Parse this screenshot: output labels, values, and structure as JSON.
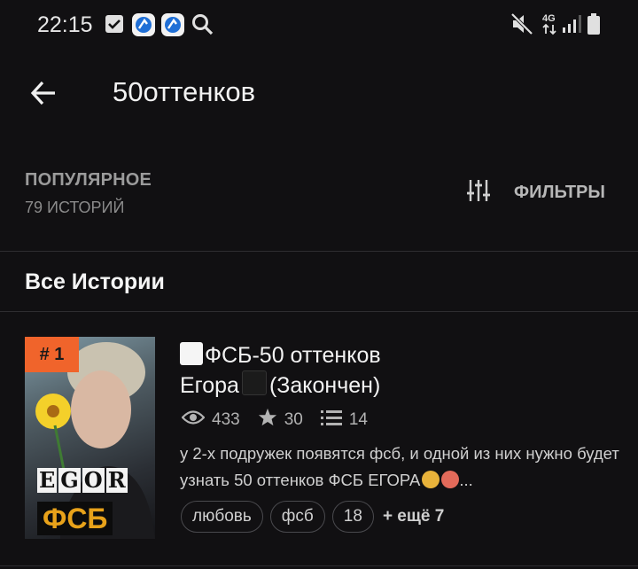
{
  "status_bar": {
    "time": "22:15",
    "icons": [
      "checkbox-notification-icon",
      "app-icon",
      "app-icon",
      "search-icon",
      "mute-icon",
      "network-4g-icon",
      "signal-icon",
      "battery-icon"
    ],
    "network_label": "4G"
  },
  "app_bar": {
    "back_icon": "arrow-left-icon",
    "search_query": "50оттенков"
  },
  "sort": {
    "label": "ПОПУЛЯРНОЕ",
    "count": "79 ИСТОРИЙ"
  },
  "filters": {
    "icon": "sliders-icon",
    "label": "ФИЛЬТРЫ"
  },
  "section_title": "Все Истории",
  "stories": [
    {
      "rank": "# 1",
      "cover_text": [
        "E",
        "G",
        "O",
        "R"
      ],
      "cover_subtitle": "ФСБ",
      "title_part1": "ФСБ-50 оттенков",
      "title_part2": "Егора",
      "title_part3": "(Закончен)",
      "reads": "433",
      "votes": "30",
      "parts": "14",
      "description": "у 2-х подружек появятся фсб, и одной из них нужно будет узнать 50 оттенков ФСБ ЕГОРА",
      "description_ellipsis": "...",
      "tags": [
        "любовь",
        "фсб",
        "18"
      ],
      "more_tags": "+ ещё 7"
    }
  ],
  "colors": {
    "background": "#111012",
    "rank_badge": "#f0642b",
    "divider": "#2e2d30"
  }
}
